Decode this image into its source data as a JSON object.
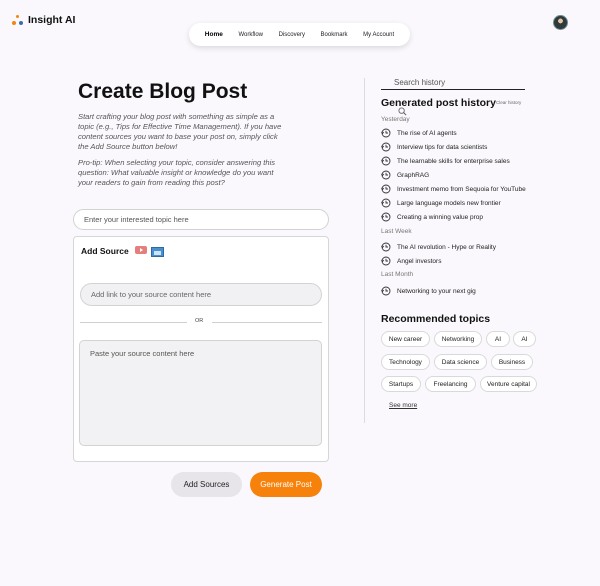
{
  "app": {
    "name": "Insight AI"
  },
  "nav": {
    "items": [
      "Home",
      "Workflow",
      "Discovery",
      "Bookmark",
      "My Account"
    ]
  },
  "main": {
    "title": "Create Blog Post",
    "intro": "Start crafting your blog post with something as simple as a topic (e.g., Tips for Effective Time Management). If you have content sources you want to base your post on, simply click the Add Source button below!",
    "tip": "Pro-tip: When selecting your topic, consider answering this question: What valuable insight or knowledge do you want your readers to gain from reading this post?",
    "topic_placeholder": "Enter your interested topic here",
    "add_source_label": "Add Source",
    "link_placeholder": "Add link to your source content here",
    "or_text": "OR",
    "paste_placeholder": "Paste your source content here",
    "add_sources_button": "Add Sources",
    "generate_button": "Generate Post"
  },
  "history": {
    "search_placeholder": "Search history",
    "title": "Generated post history",
    "clear_label": "Clear history",
    "groups": [
      {
        "label": "Yesterday",
        "items": [
          "The rise of AI agents",
          "Interview tips for data scientists",
          "The learnable skills for enterprise sales",
          "GraphRAG",
          "Investment memo from Sequoia for YouTube",
          "Large language models new frontier",
          "Creating a winning value prop"
        ]
      },
      {
        "label": "Last Week",
        "items": [
          "The AI revolution - Hype or Reality",
          "Angel investors"
        ]
      },
      {
        "label": "Last Month",
        "items": [
          "Networking to your next gig"
        ]
      }
    ]
  },
  "topics": {
    "title": "Recommended topics",
    "chips": [
      "New career",
      "Networking",
      "AI",
      "AI",
      "Technology",
      "Data science",
      "Business",
      "Startups",
      "Freelancing",
      "Venture capital"
    ],
    "see_more": "See more"
  },
  "colors": {
    "accent": "#f6820c",
    "background": "#faf8fc"
  }
}
